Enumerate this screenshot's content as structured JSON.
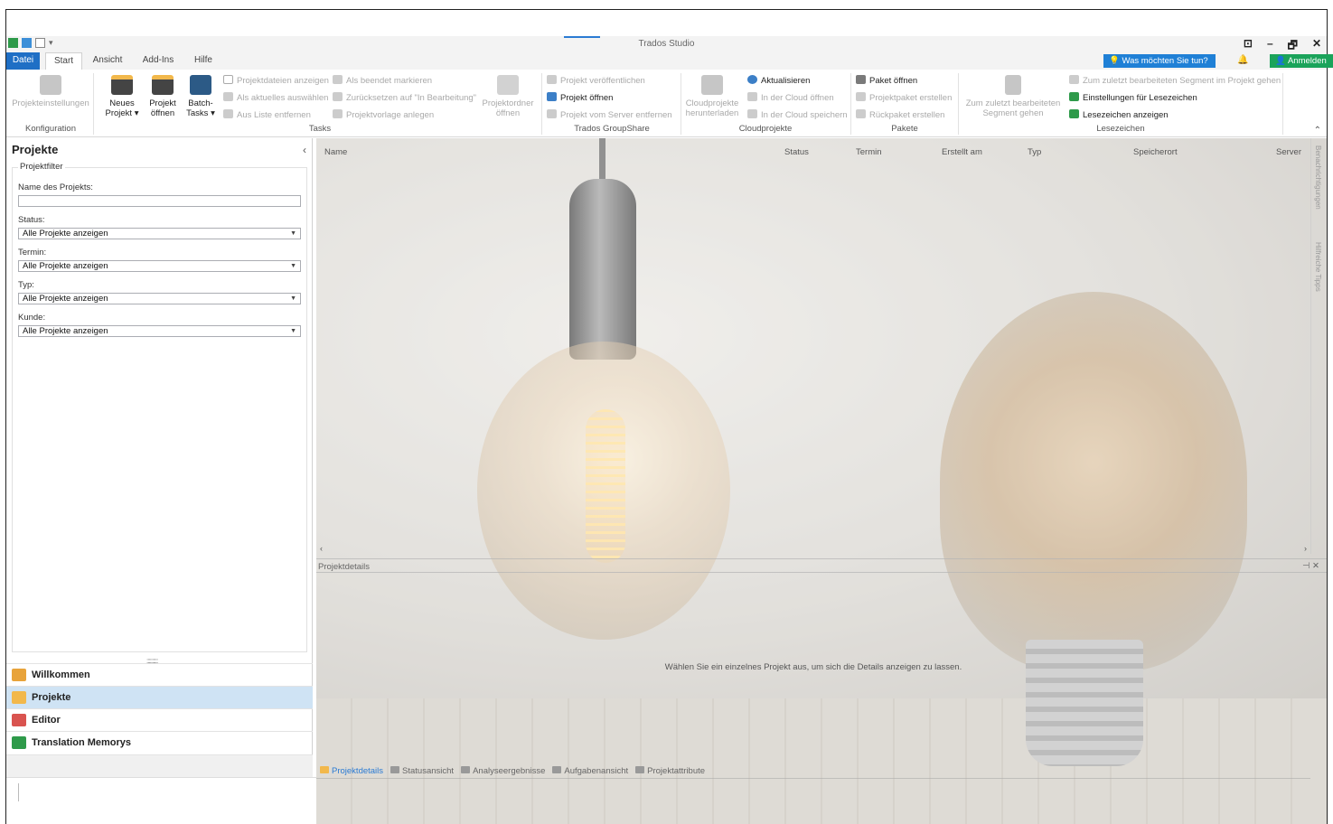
{
  "app": {
    "title": "Trados Studio"
  },
  "window_controls": [
    "⊡",
    "–",
    "🗗",
    "✕"
  ],
  "tabs": [
    {
      "label": "Datei"
    },
    {
      "label": "Start"
    },
    {
      "label": "Ansicht"
    },
    {
      "label": "Add-Ins"
    },
    {
      "label": "Hilfe"
    }
  ],
  "help_search": "Was möchten Sie tun?",
  "login": "Anmelden",
  "ribbon": {
    "projekteinstellungen": "Projekteinstellungen",
    "neues_projekt": "Neues Projekt ▾",
    "projekt_oeffnen": "Projekt öffnen",
    "batch_tasks": "Batch-Tasks ▾",
    "projektdateien_anzeigen": "Projektdateien anzeigen",
    "als_aktuelles_auswaehlen": "Als aktuelles auswählen",
    "aus_liste_entfernen": "Aus Liste entfernen",
    "als_beendet_markieren": "Als beendet markieren",
    "zuruecksetzen": "Zurücksetzen auf \"In Bearbeitung\"",
    "projektvorlage_anlegen": "Projektvorlage anlegen",
    "projektordner_oeffnen": "Projektordner öffnen",
    "projekt_veroeffentlichen": "Projekt veröffentlichen",
    "gs_projekt_oeffnen": "Projekt öffnen",
    "projekt_vom_server_entfernen": "Projekt vom Server entfernen",
    "cloudprojekte_herunterladen": "Cloudprojekte herunterladen",
    "aktualisieren": "Aktualisieren",
    "in_der_cloud_oeffnen": "In der Cloud öffnen",
    "in_der_cloud_speichern": "In der Cloud speichern",
    "paket_oeffnen": "Paket öffnen",
    "projektpaket_erstellen": "Projektpaket erstellen",
    "rueckpaket_erstellen": "Rückpaket erstellen",
    "zum_zuletzt_bearbeiteten_segment": "Zum zuletzt bearbeiteten Segment gehen",
    "zum_zuletzt_bearbeiteten_segment_im_projekt": "Zum zuletzt bearbeiteten Segment im Projekt gehen",
    "einstellungen_fuer_lesezeichen": "Einstellungen für Lesezeichen",
    "lesezeichen_anzeigen": "Lesezeichen anzeigen",
    "groups": {
      "konfiguration": "Konfiguration",
      "tasks": "Tasks",
      "groupshare": "Trados GroupShare",
      "cloudprojekte": "Cloudprojekte",
      "pakete": "Pakete",
      "lesezeichen": "Lesezeichen"
    }
  },
  "left_panel": {
    "title": "Projekte",
    "filter_title": "Projektfilter",
    "name_label": "Name des Projekts:",
    "status_label": "Status:",
    "status_value": "Alle Projekte anzeigen",
    "termin_label": "Termin:",
    "termin_value": "Alle Projekte anzeigen",
    "typ_label": "Typ:",
    "typ_value": "Alle Projekte anzeigen",
    "kunde_label": "Kunde:",
    "kunde_value": "Alle Projekte anzeigen"
  },
  "nav": [
    {
      "label": "Willkommen",
      "color": "#e8a33a"
    },
    {
      "label": "Projekte",
      "color": "#f2b84b"
    },
    {
      "label": "Editor",
      "color": "#d9534f"
    },
    {
      "label": "Translation Memorys",
      "color": "#2e9a4a"
    }
  ],
  "columns": [
    "Name",
    "Status",
    "Termin",
    "Erstellt am",
    "Typ",
    "Speicherort",
    "Server"
  ],
  "side_tabs": [
    "Benachrichtigungen",
    "Hilfreiche Tipps"
  ],
  "details": {
    "title": "Projektdetails",
    "message": "Wählen Sie ein einzelnes Projekt aus, um sich die Details anzeigen zu lassen."
  },
  "bottom_tabs": [
    "Projektdetails",
    "Statusansicht",
    "Analyseergebnisse",
    "Aufgabenansicht",
    "Projektattribute"
  ]
}
